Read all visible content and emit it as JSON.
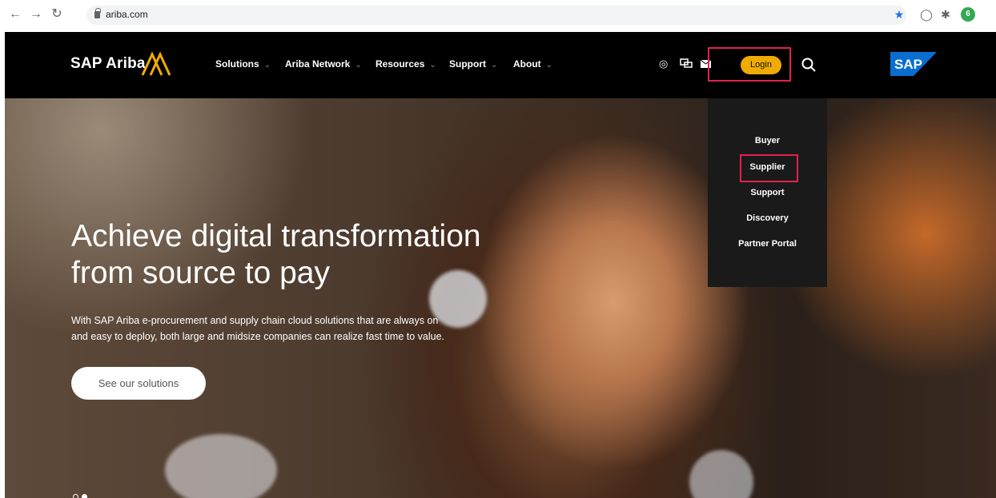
{
  "browser": {
    "url": "ariba.com",
    "profile_initial": "6",
    "icons": [
      "back-icon",
      "forward-icon",
      "reload-icon",
      "lock-icon",
      "bookmark-star-icon",
      "extension-icon",
      "puzzle-icon",
      "profile-avatar"
    ]
  },
  "header": {
    "brand": "SAP Ariba",
    "nav": [
      {
        "label": "Solutions"
      },
      {
        "label": "Ariba Network"
      },
      {
        "label": "Resources"
      },
      {
        "label": "Support"
      },
      {
        "label": "About"
      }
    ],
    "login_label": "Login",
    "sap_logo": "SAP",
    "utility_icons": [
      "globe-icon",
      "chat-icon",
      "mail-icon",
      "search-icon"
    ]
  },
  "dropdown": {
    "items": [
      {
        "label": "Buyer"
      },
      {
        "label": "Supplier"
      },
      {
        "label": "Support"
      },
      {
        "label": "Discovery"
      },
      {
        "label": "Partner Portal"
      }
    ]
  },
  "hero": {
    "title_line1": "Achieve digital transformation",
    "title_line2": "from source to pay",
    "desc_line1": "With SAP Ariba e-procurement and supply chain cloud solutions that are always on",
    "desc_line2": "and easy to deploy, both large and midsize companies can realize fast time to value.",
    "cta": "See our solutions"
  },
  "colors": {
    "accent": "#f0ab00",
    "highlight": "#e0224d",
    "sap_blue": "#0a6ed1"
  }
}
